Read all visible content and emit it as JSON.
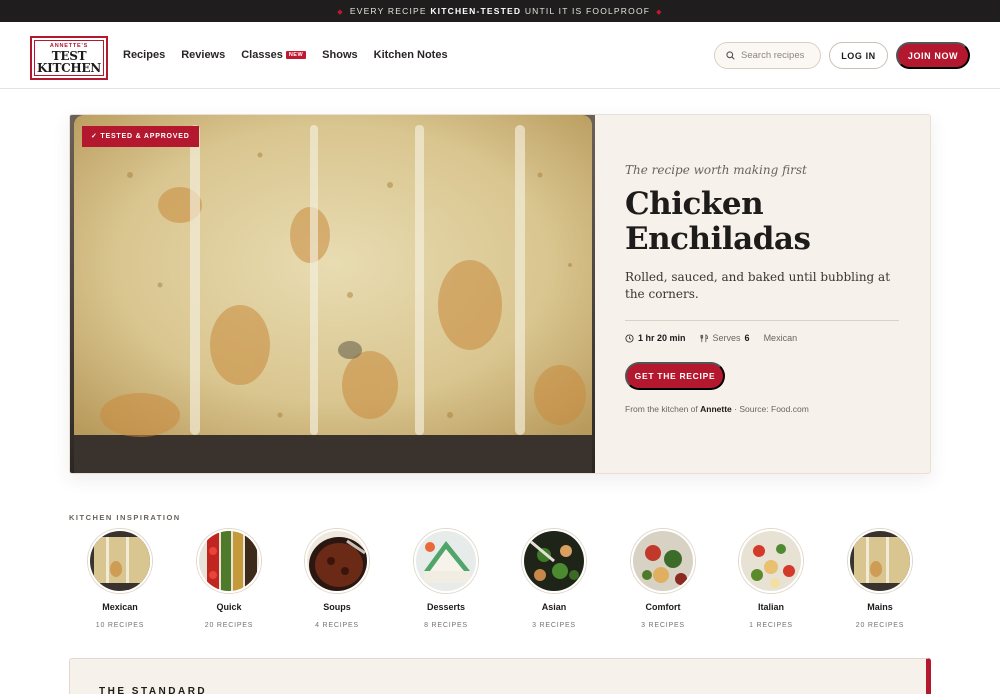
{
  "announcement": {
    "before": "EVERY RECIPE",
    "bold": "KITCHEN-TESTED",
    "after": "UNTIL IT IS FOOLPROOF"
  },
  "brand": {
    "small": "ANNETTE'S",
    "line1": "TEST",
    "line2": "KITCHEN",
    "accent": "#b3182e"
  },
  "nav": {
    "items": [
      {
        "label": "Recipes"
      },
      {
        "label": "Reviews"
      },
      {
        "label": "Classes",
        "badge": "NEW"
      },
      {
        "label": "Shows"
      },
      {
        "label": "Kitchen Notes"
      }
    ]
  },
  "search": {
    "placeholder": "Search recipes",
    "value": "",
    "icon": "search-icon"
  },
  "auth": {
    "login": "LOG IN",
    "join": "JOIN NOW"
  },
  "hero": {
    "tag": "✓ TESTED & APPROVED",
    "kicker": "The recipe worth making first",
    "title": "Chicken Enchiladas",
    "description": "Rolled, sauced, and baked until bubbling at the corners.",
    "time": "1 hr 20 min",
    "serves_label": "Serves",
    "serves": "6",
    "cuisine": "Mexican",
    "cta": "GET THE RECIPE",
    "source_prefix": "From the kitchen of",
    "author": "Annette",
    "source_suffix": "· Source: Food.com"
  },
  "inspiration": {
    "label": "KITCHEN INSPIRATION",
    "categories": [
      {
        "name": "Mexican",
        "count": "10 RECIPES"
      },
      {
        "name": "Quick",
        "count": "20 RECIPES"
      },
      {
        "name": "Soups",
        "count": "4 RECIPES"
      },
      {
        "name": "Desserts",
        "count": "8 RECIPES"
      },
      {
        "name": "Asian",
        "count": "3 RECIPES"
      },
      {
        "name": "Comfort",
        "count": "3 RECIPES"
      },
      {
        "name": "Italian",
        "count": "1 RECIPES"
      },
      {
        "name": "Mains",
        "count": "20 RECIPES"
      }
    ]
  },
  "standard": {
    "label": "THE STANDARD"
  }
}
